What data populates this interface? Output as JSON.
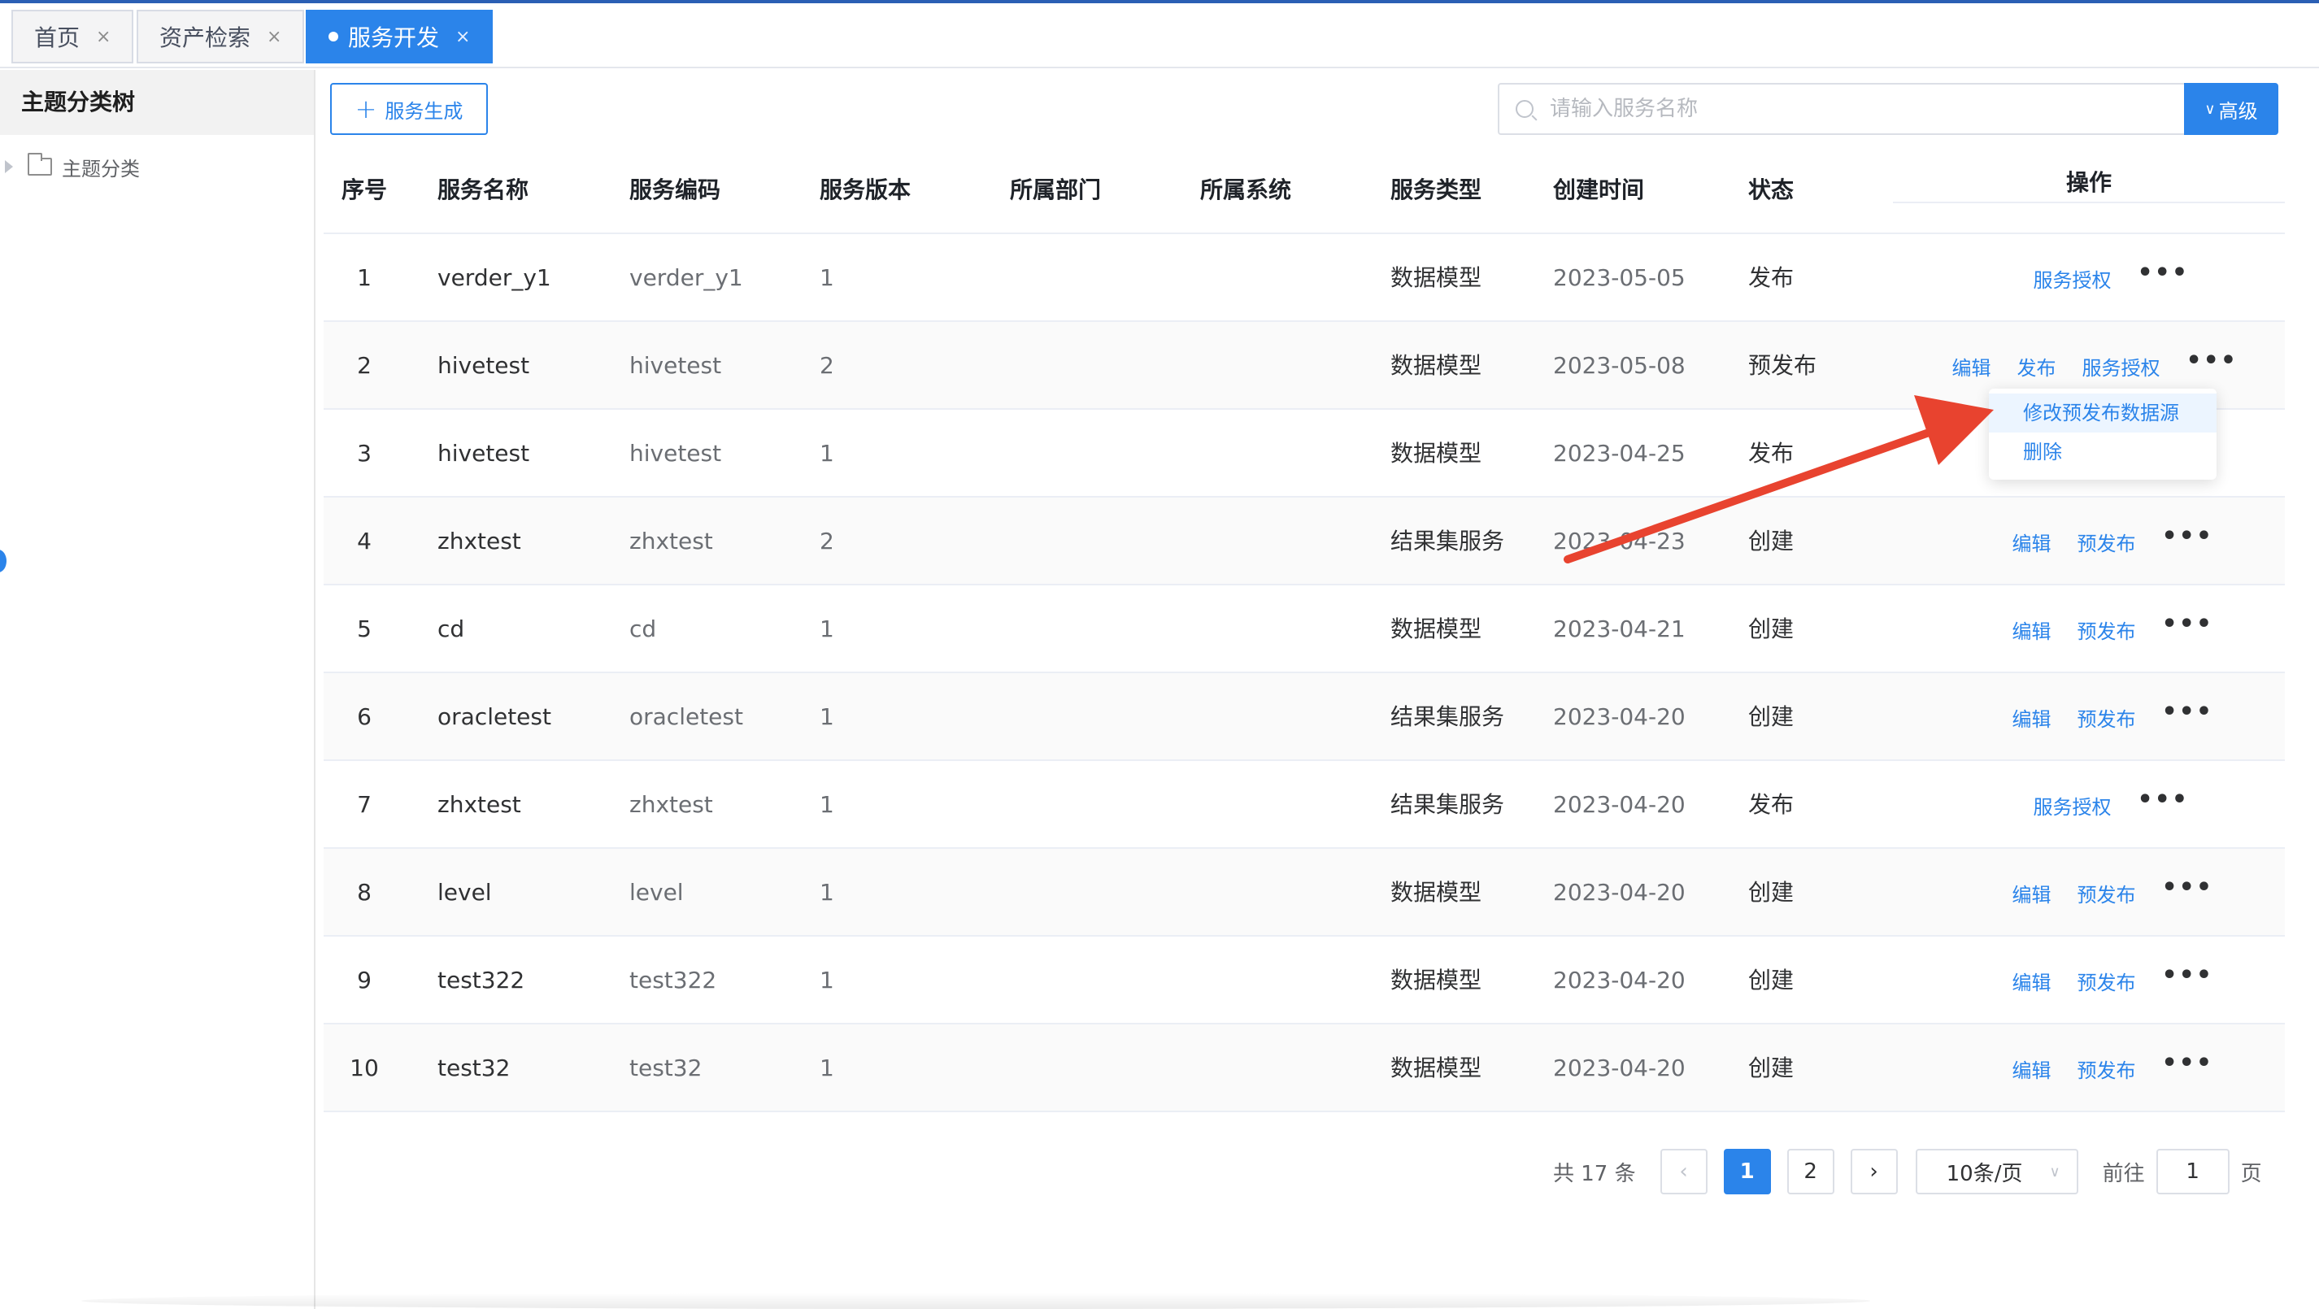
{
  "tabs": [
    {
      "label": "首页",
      "close": "×"
    },
    {
      "label": "资产检索",
      "close": "×"
    },
    {
      "label": "服务开发",
      "close": "×"
    }
  ],
  "sidebar": {
    "title": "主题分类树",
    "tree": [
      {
        "label": "主题分类"
      }
    ]
  },
  "toolbar": {
    "generate_label": "服务生成",
    "search_placeholder": "请输入服务名称",
    "advanced_label": "高级"
  },
  "table": {
    "headers": {
      "index": "序号",
      "name": "服务名称",
      "code": "服务编码",
      "version": "服务版本",
      "dept": "所属部门",
      "system": "所属系统",
      "type": "服务类型",
      "created": "创建时间",
      "status": "状态",
      "ops": "操作"
    },
    "rows": [
      {
        "index": "1",
        "name": "verder_y1",
        "code": "verder_y1",
        "version": "1",
        "dept": "",
        "system": "",
        "type": "数据模型",
        "created": "2023-05-05",
        "status": "发布",
        "ops": [
          "服务授权"
        ]
      },
      {
        "index": "2",
        "name": "hivetest",
        "code": "hivetest",
        "version": "2",
        "dept": "",
        "system": "",
        "type": "数据模型",
        "created": "2023-05-08",
        "status": "预发布",
        "ops": [
          "编辑",
          "发布",
          "服务授权"
        ]
      },
      {
        "index": "3",
        "name": "hivetest",
        "code": "hivetest",
        "version": "1",
        "dept": "",
        "system": "",
        "type": "数据模型",
        "created": "2023-04-25",
        "status": "发布",
        "ops": []
      },
      {
        "index": "4",
        "name": "zhxtest",
        "code": "zhxtest",
        "version": "2",
        "dept": "",
        "system": "",
        "type": "结果集服务",
        "created": "2023-04-23",
        "status": "创建",
        "ops": [
          "编辑",
          "预发布"
        ]
      },
      {
        "index": "5",
        "name": "cd",
        "code": "cd",
        "version": "1",
        "dept": "",
        "system": "",
        "type": "数据模型",
        "created": "2023-04-21",
        "status": "创建",
        "ops": [
          "编辑",
          "预发布"
        ]
      },
      {
        "index": "6",
        "name": "oracletest",
        "code": "oracletest",
        "version": "1",
        "dept": "",
        "system": "",
        "type": "结果集服务",
        "created": "2023-04-20",
        "status": "创建",
        "ops": [
          "编辑",
          "预发布"
        ]
      },
      {
        "index": "7",
        "name": "zhxtest",
        "code": "zhxtest",
        "version": "1",
        "dept": "",
        "system": "",
        "type": "结果集服务",
        "created": "2023-04-20",
        "status": "发布",
        "ops": [
          "服务授权"
        ]
      },
      {
        "index": "8",
        "name": "level",
        "code": "level",
        "version": "1",
        "dept": "",
        "system": "",
        "type": "数据模型",
        "created": "2023-04-20",
        "status": "创建",
        "ops": [
          "编辑",
          "预发布"
        ]
      },
      {
        "index": "9",
        "name": "test322",
        "code": "test322",
        "version": "1",
        "dept": "",
        "system": "",
        "type": "数据模型",
        "created": "2023-04-20",
        "status": "创建",
        "ops": [
          "编辑",
          "预发布"
        ]
      },
      {
        "index": "10",
        "name": "test32",
        "code": "test32",
        "version": "1",
        "dept": "",
        "system": "",
        "type": "数据模型",
        "created": "2023-04-20",
        "status": "创建",
        "ops": [
          "编辑",
          "预发布"
        ]
      }
    ],
    "more_label": "•••"
  },
  "dropdown": {
    "items": [
      "修改预发布数据源",
      "删除"
    ]
  },
  "pagination": {
    "total": "共 17 条",
    "prev": "‹",
    "pages": [
      "1",
      "2"
    ],
    "next": "›",
    "page_size": "10条/页",
    "goto_label": "前往",
    "goto_value": "1",
    "page_suffix": "页"
  },
  "colors": {
    "accent": "#2b84ea",
    "annotation_arrow": "#e8432f"
  },
  "icons": {
    "tab_close": "close-icon",
    "tree_caret": "caret-right-icon",
    "tree_folder": "folder-icon",
    "search": "search-icon",
    "advanced": "chevron-down-icon",
    "more": "more-icon"
  }
}
